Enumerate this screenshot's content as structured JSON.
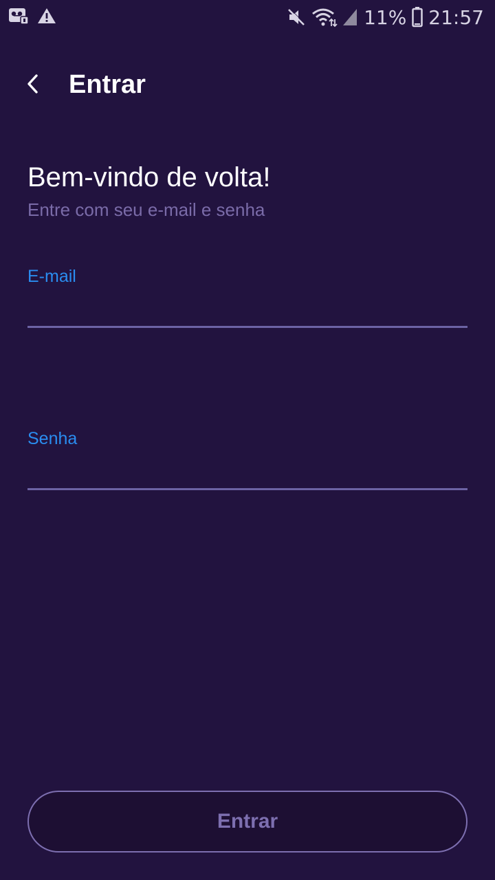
{
  "status_bar": {
    "left_icons": [
      "voicemail-icon",
      "warning-icon"
    ],
    "right_icons": [
      "mute-icon",
      "wifi-icon",
      "signal-icon",
      "battery-icon"
    ],
    "battery": "11%",
    "time": "21:57"
  },
  "app_bar": {
    "back_icon": "chevron-left-icon",
    "title": "Entrar"
  },
  "welcome": {
    "title": "Bem-vindo de volta!",
    "subtitle": "Entre com seu e-mail e senha"
  },
  "form": {
    "email": {
      "label": "E-mail",
      "value": "",
      "placeholder": ""
    },
    "password": {
      "label": "Senha",
      "value": "",
      "placeholder": ""
    },
    "submit_label": "Entrar"
  },
  "colors": {
    "background": "#22133f",
    "accent_label": "#2a8df0",
    "muted_text": "#7a6ba8",
    "underline": "#6c63a4",
    "button_border": "#7d6fb0"
  }
}
